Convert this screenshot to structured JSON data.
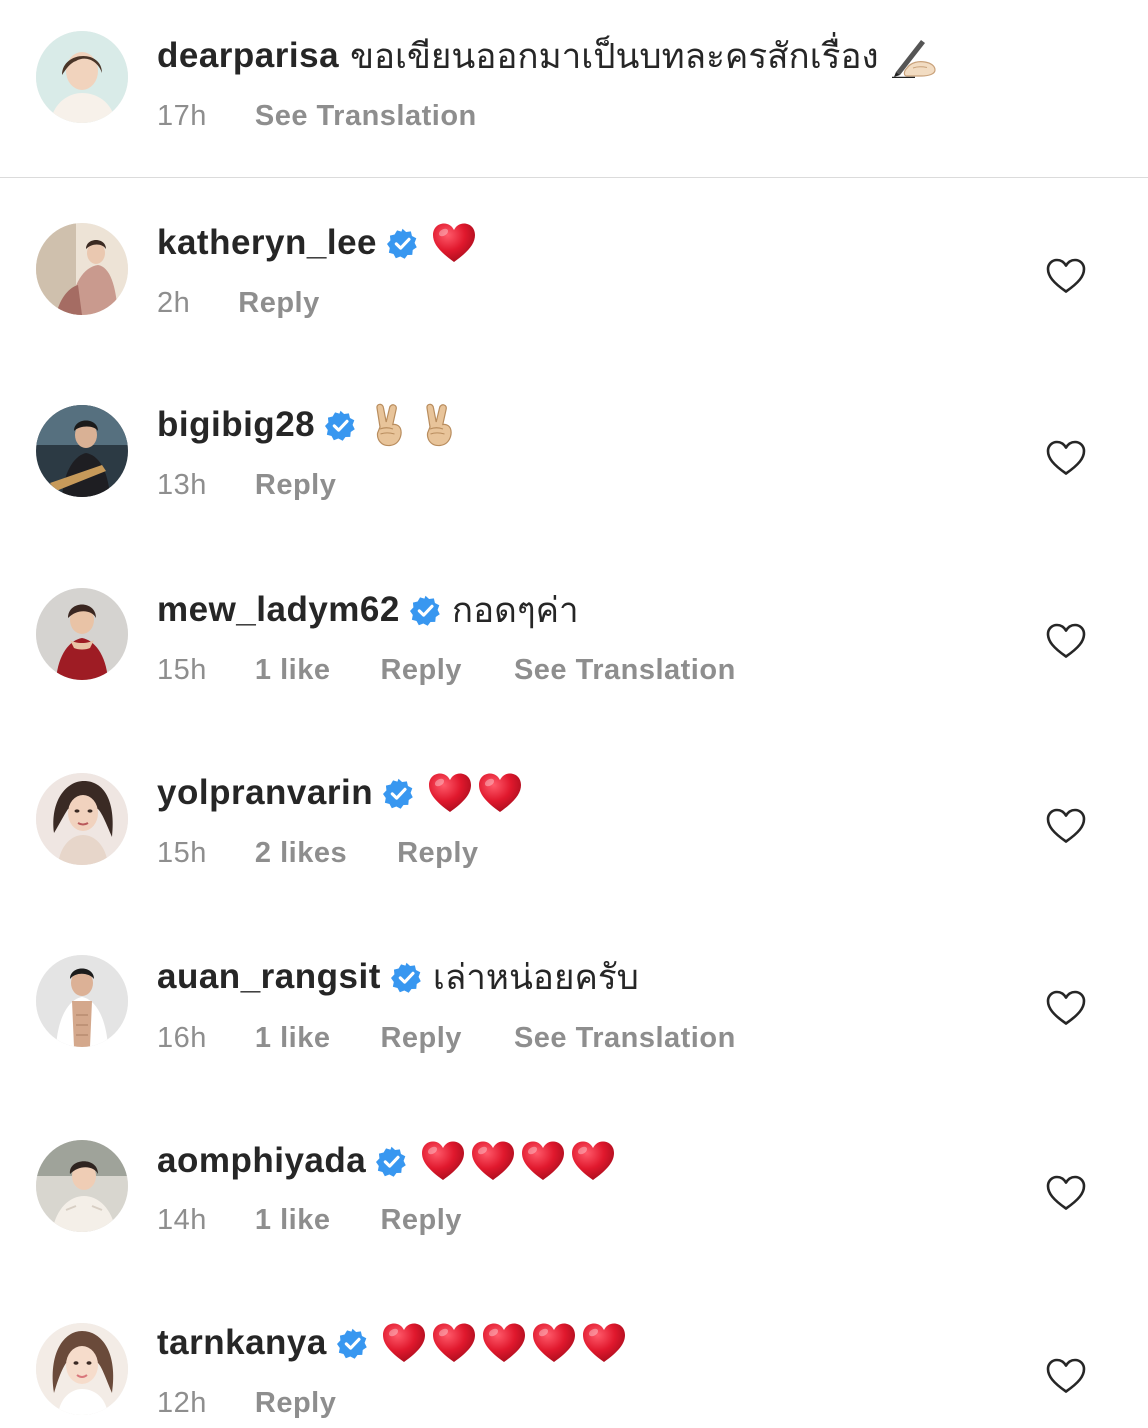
{
  "caption": {
    "username": "dearparisa",
    "text": "ขอเขียนออกมาเป็นบทละครสักเรื่อง",
    "time": "17h",
    "translate": "See Translation",
    "emoji": "writing-hand"
  },
  "comments": [
    {
      "username": "katheryn_lee",
      "text": "",
      "emoji": "heart",
      "emoji_count": 1,
      "time": "2h",
      "likes": "",
      "reply": "Reply",
      "translate": ""
    },
    {
      "username": "bigibig28",
      "text": "",
      "emoji": "victory-hand",
      "emoji_count": 2,
      "time": "13h",
      "likes": "",
      "reply": "Reply",
      "translate": ""
    },
    {
      "username": "mew_ladym62",
      "text": "กอดๆค่า",
      "emoji": "",
      "emoji_count": 0,
      "time": "15h",
      "likes": "1 like",
      "reply": "Reply",
      "translate": "See Translation"
    },
    {
      "username": "yolpranvarin",
      "text": "",
      "emoji": "heart",
      "emoji_count": 2,
      "time": "15h",
      "likes": "2 likes",
      "reply": "Reply",
      "translate": ""
    },
    {
      "username": "auan_rangsit",
      "text": "เล่าหน่อยครับ",
      "emoji": "",
      "emoji_count": 0,
      "time": "16h",
      "likes": "1 like",
      "reply": "Reply",
      "translate": "See Translation"
    },
    {
      "username": "aomphiyada",
      "text": "",
      "emoji": "heart",
      "emoji_count": 4,
      "time": "14h",
      "likes": "1 like",
      "reply": "Reply",
      "translate": ""
    },
    {
      "username": "tarnkanya",
      "text": "",
      "emoji": "heart",
      "emoji_count": 5,
      "time": "12h",
      "likes": "",
      "reply": "Reply",
      "translate": ""
    }
  ],
  "colors": {
    "text_primary": "#262626",
    "text_secondary": "#8e8e8e",
    "verified_blue": "#3897f0",
    "heart_red": "#e0182d",
    "divider": "#dbdbdb"
  }
}
